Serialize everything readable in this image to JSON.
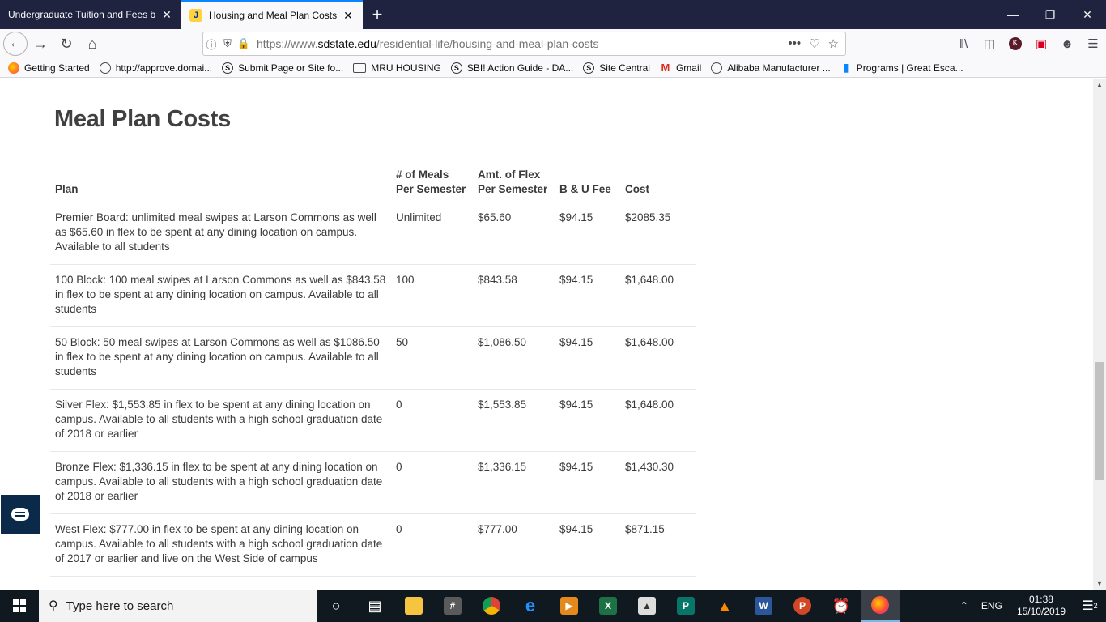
{
  "browser": {
    "tabs": [
      {
        "title": "Undergraduate Tuition and Fees by",
        "active": false
      },
      {
        "title": "Housing and Meal Plan Costs |",
        "active": true
      }
    ],
    "url_prefix": "https://www.",
    "url_domain": "sdstate.edu",
    "url_path": "/residential-life/housing-and-meal-plan-costs",
    "bookmarks": [
      {
        "label": "Getting Started",
        "icon": "firefox-icon"
      },
      {
        "label": "http://approve.domai...",
        "icon": "globe-icon"
      },
      {
        "label": "Submit Page or Site fo...",
        "icon": "dollar-icon"
      },
      {
        "label": "MRU HOUSING",
        "icon": "folder-icon"
      },
      {
        "label": "SBI! Action Guide - DA...",
        "icon": "dollar-icon"
      },
      {
        "label": "Site Central",
        "icon": "dollar-icon"
      },
      {
        "label": "Gmail",
        "icon": "gmail-icon"
      },
      {
        "label": "Alibaba Manufacturer ...",
        "icon": "globe-icon"
      },
      {
        "label": "Programs | Great Esca...",
        "icon": "bookmark-icon"
      }
    ],
    "profile_initial": "K"
  },
  "page": {
    "heading": "Meal Plan Costs",
    "table": {
      "headers": [
        "Plan",
        "# of Meals Per Semester",
        "Amt. of Flex Per Semester",
        "B & U Fee",
        "Cost"
      ],
      "rows": [
        [
          "Premier Board: unlimited meal swipes at Larson Commons as well as $65.60 in flex to be spent at any dining location on campus. Available to all students",
          "Unlimited",
          "$65.60",
          "$94.15",
          "$2085.35"
        ],
        [
          "100 Block: 100 meal swipes at Larson Commons as well as $843.58 in flex to be spent at any dining location on campus. Available to all students",
          "100",
          "$843.58",
          "$94.15",
          "$1,648.00"
        ],
        [
          "50 Block: 50 meal swipes at Larson Commons as well as $1086.50 in flex to be spent at any dining location on campus. Available to all students",
          "50",
          "$1,086.50",
          "$94.15",
          "$1,648.00"
        ],
        [
          "Silver Flex: $1,553.85 in flex to be spent at any dining location on campus. Available to all students with a high school graduation date of 2018 or earlier",
          "0",
          "$1,553.85",
          "$94.15",
          "$1,648.00"
        ],
        [
          "Bronze Flex: $1,336.15 in flex to be spent at any dining location on campus. Available to all students with a high school graduation date of 2018 or earlier",
          "0",
          "$1,336.15",
          "$94.15",
          "$1,430.30"
        ],
        [
          "West Flex: $777.00 in flex to be spent at any dining location on campus. Available to all students with a high school graduation date of 2017 or earlier and live on the West Side of campus",
          "0",
          "$777.00",
          "$94.15",
          "$871.15"
        ]
      ]
    }
  },
  "taskbar": {
    "search_placeholder": "Type here to search",
    "language": "ENG",
    "time": "01:38",
    "date": "15/10/2019",
    "notification_count": "2"
  }
}
